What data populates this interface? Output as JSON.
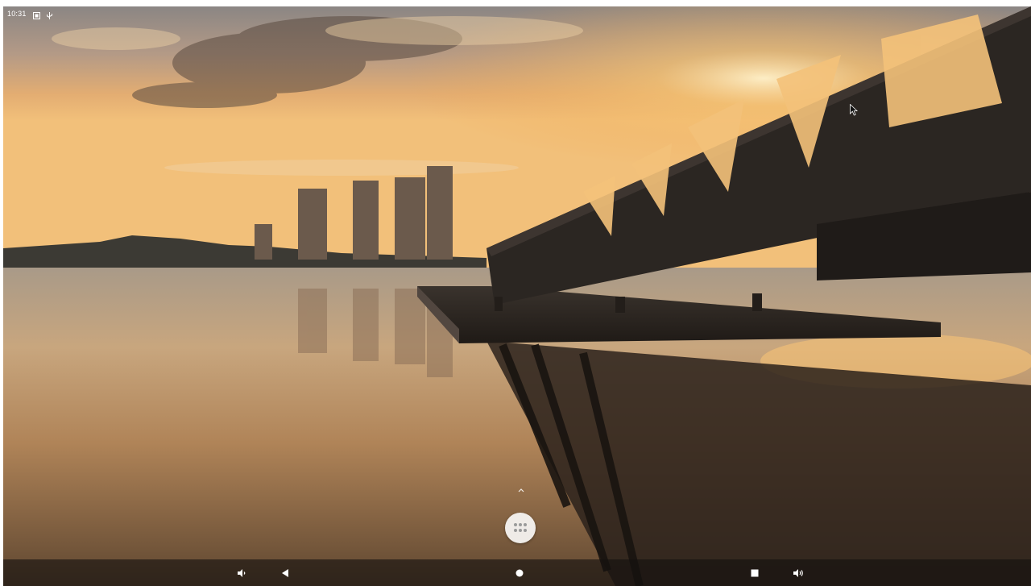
{
  "status_bar": {
    "time": "10:31",
    "icons": [
      "screenshot-notification-icon",
      "usb-icon"
    ]
  },
  "wallpaper": {
    "scene": "sunset-bridge-wallpaper",
    "colors": {
      "sky_top": "#8e8a88",
      "sky_glow": "#f3b462",
      "horizon": "#f6c77a",
      "water": "#b58e62",
      "structure": "#2b2622"
    }
  },
  "home": {
    "drawer_hint_icon": "chevron-up-icon",
    "app_drawer_icon": "apps-grid-icon"
  },
  "navigation_bar": {
    "buttons": [
      {
        "name": "volume-down-icon",
        "role": "volume down"
      },
      {
        "name": "back-icon",
        "role": "back"
      },
      {
        "name": "home-icon",
        "role": "home"
      },
      {
        "name": "recents-icon",
        "role": "recent apps"
      },
      {
        "name": "volume-up-icon",
        "role": "volume up"
      }
    ],
    "background": "#14100e"
  }
}
